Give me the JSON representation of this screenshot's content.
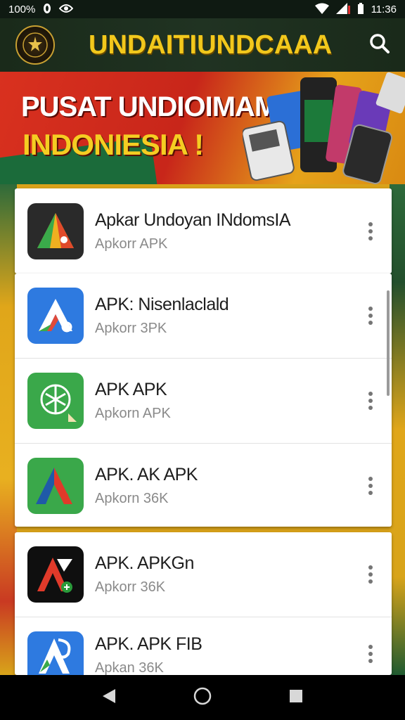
{
  "status_bar": {
    "battery_text": "100%",
    "time": "11:36"
  },
  "app_bar": {
    "title": "UNDAITIUNDCAAA"
  },
  "banner": {
    "line1": "PUSAT UNDIOIMAMI",
    "line2": "INDONIESIA !"
  },
  "apps": [
    {
      "name": "Apkar Undoyan INdomsIA",
      "subtitle": "Apkorr APK"
    },
    {
      "name": "APK: Nisenlaclald",
      "subtitle": "Apkorr 3PK"
    },
    {
      "name": "APK APK",
      "subtitle": "Apkorn APK"
    },
    {
      "name": "APK. AK APK",
      "subtitle": "Apkorn 36K"
    },
    {
      "name": "APK. APKGn",
      "subtitle": "Apkorr 36K"
    },
    {
      "name": "APK. APK FIB",
      "subtitle": "Apkan 36K"
    }
  ],
  "colors": {
    "accent_gold": "#f2c81c",
    "banner_red": "#d9311f",
    "dark_green": "#1a2a1a"
  },
  "icons": {
    "search": "search-icon",
    "more": "more-vert-icon",
    "nav_back": "back-triangle-icon",
    "nav_home": "home-circle-icon",
    "nav_recents": "recents-square-icon"
  }
}
